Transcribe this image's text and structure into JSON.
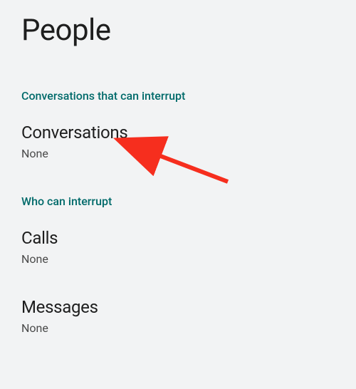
{
  "header": {
    "title": "People"
  },
  "sections": [
    {
      "header": "Conversations that can interrupt",
      "items": [
        {
          "title": "Conversations",
          "value": "None"
        }
      ]
    },
    {
      "header": "Who can interrupt",
      "items": [
        {
          "title": "Calls",
          "value": "None"
        },
        {
          "title": "Messages",
          "value": "None"
        }
      ]
    }
  ],
  "annotation": {
    "arrow_color": "#f62e1e"
  }
}
